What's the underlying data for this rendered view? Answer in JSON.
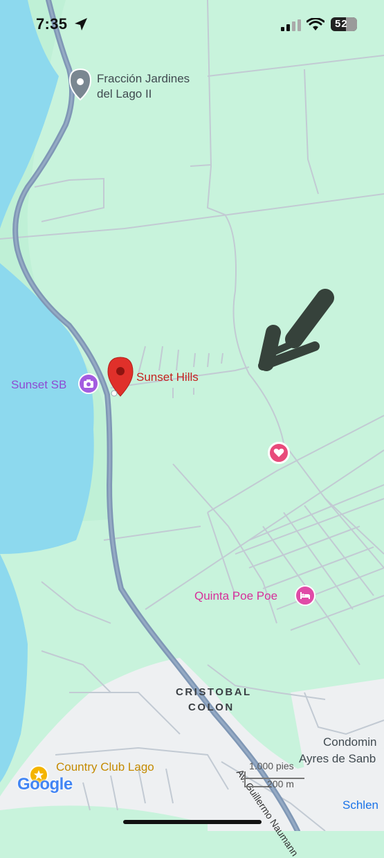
{
  "status_bar": {
    "time": "7:35",
    "battery": "52"
  },
  "map": {
    "places": {
      "fraccion": "Fracción Jardines\ndel Lago II",
      "sunset_hills": "Sunset Hills",
      "sunset_sb": "Sunset SB",
      "quinta": "Quinta Poe Poe",
      "country_club": "Country Club Lago",
      "condominio_1": "Condomin",
      "condominio_2": "Ayres de Sanb",
      "schlen": "Schlen",
      "city_1": "CRISTOBAL",
      "city_2": "COLON",
      "road": "Av. Guillermo Naumann"
    },
    "scale": {
      "imperial": "1.000 pies",
      "metric": "200 m"
    },
    "brand": "Google",
    "colors": {
      "land": "#c8f3dc",
      "water": "#8dd9ee",
      "highway": "#7f97b5",
      "pin": "#e0302a",
      "urban": "#eef0f2"
    }
  }
}
